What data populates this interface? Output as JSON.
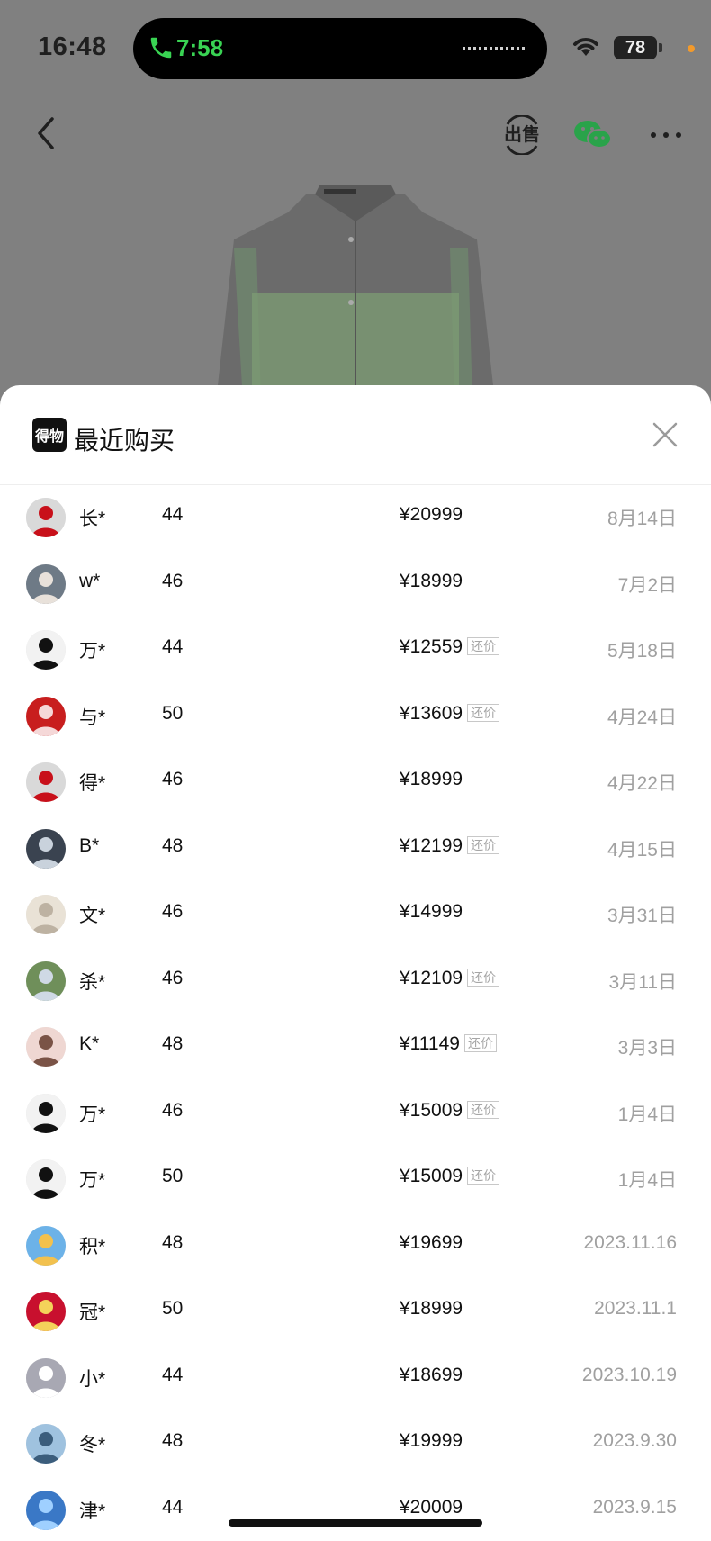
{
  "status_bar": {
    "time": "16:48",
    "call_time": "7:58",
    "battery": "78"
  },
  "sheet": {
    "brand": "得物",
    "title": "最近购买"
  },
  "tag_label": "还价",
  "purchases": [
    {
      "name": "长*",
      "size": "44",
      "price": "¥20999",
      "tag": "",
      "date": "8月14日",
      "avatar": {
        "bg": "#d9d9d9",
        "fg": "#c8101a"
      }
    },
    {
      "name": "w*",
      "size": "46",
      "price": "¥18999",
      "tag": "",
      "date": "7月2日",
      "avatar": {
        "bg": "#6e7a86",
        "fg": "#e8e1da"
      }
    },
    {
      "name": "万*",
      "size": "44",
      "price": "¥12559",
      "tag": "还价",
      "date": "5月18日",
      "avatar": {
        "bg": "#f2f2f2",
        "fg": "#111111"
      }
    },
    {
      "name": "与*",
      "size": "50",
      "price": "¥13609",
      "tag": "还价",
      "date": "4月24日",
      "avatar": {
        "bg": "#c81e1e",
        "fg": "#f5d8d8"
      }
    },
    {
      "name": "得*",
      "size": "46",
      "price": "¥18999",
      "tag": "",
      "date": "4月22日",
      "avatar": {
        "bg": "#d9d9d9",
        "fg": "#c8101a"
      }
    },
    {
      "name": "B*",
      "size": "48",
      "price": "¥12199",
      "tag": "还价",
      "date": "4月15日",
      "avatar": {
        "bg": "#3a4350",
        "fg": "#c9d2dc"
      }
    },
    {
      "name": "文*",
      "size": "46",
      "price": "¥14999",
      "tag": "",
      "date": "3月31日",
      "avatar": {
        "bg": "#e9e2d6",
        "fg": "#bdb2a2"
      }
    },
    {
      "name": "杀*",
      "size": "46",
      "price": "¥12109",
      "tag": "还价",
      "date": "3月11日",
      "avatar": {
        "bg": "#6f8f5a",
        "fg": "#cfd9e5"
      }
    },
    {
      "name": "K*",
      "size": "48",
      "price": "¥11149",
      "tag": "还价",
      "date": "3月3日",
      "avatar": {
        "bg": "#efd7d2",
        "fg": "#7a5346"
      }
    },
    {
      "name": "万*",
      "size": "46",
      "price": "¥15009",
      "tag": "还价",
      "date": "1月4日",
      "avatar": {
        "bg": "#f2f2f2",
        "fg": "#111111"
      }
    },
    {
      "name": "万*",
      "size": "50",
      "price": "¥15009",
      "tag": "还价",
      "date": "1月4日",
      "avatar": {
        "bg": "#f2f2f2",
        "fg": "#111111"
      }
    },
    {
      "name": "积*",
      "size": "48",
      "price": "¥19699",
      "tag": "",
      "date": "2023.11.16",
      "avatar": {
        "bg": "#6cb2e8",
        "fg": "#f2c14e"
      }
    },
    {
      "name": "冠*",
      "size": "50",
      "price": "¥18999",
      "tag": "",
      "date": "2023.11.1",
      "avatar": {
        "bg": "#c8102e",
        "fg": "#f4d25a"
      }
    },
    {
      "name": "小*",
      "size": "44",
      "price": "¥18699",
      "tag": "",
      "date": "2023.10.19",
      "avatar": {
        "bg": "#a8a8b3",
        "fg": "#ffffff"
      }
    },
    {
      "name": "冬*",
      "size": "48",
      "price": "¥19999",
      "tag": "",
      "date": "2023.9.30",
      "avatar": {
        "bg": "#9fc2df",
        "fg": "#3b5d7c"
      }
    },
    {
      "name": "津*",
      "size": "44",
      "price": "¥20009",
      "tag": "",
      "date": "2023.9.15",
      "avatar": {
        "bg": "#3a78c6",
        "fg": "#9fd0ff"
      }
    }
  ]
}
